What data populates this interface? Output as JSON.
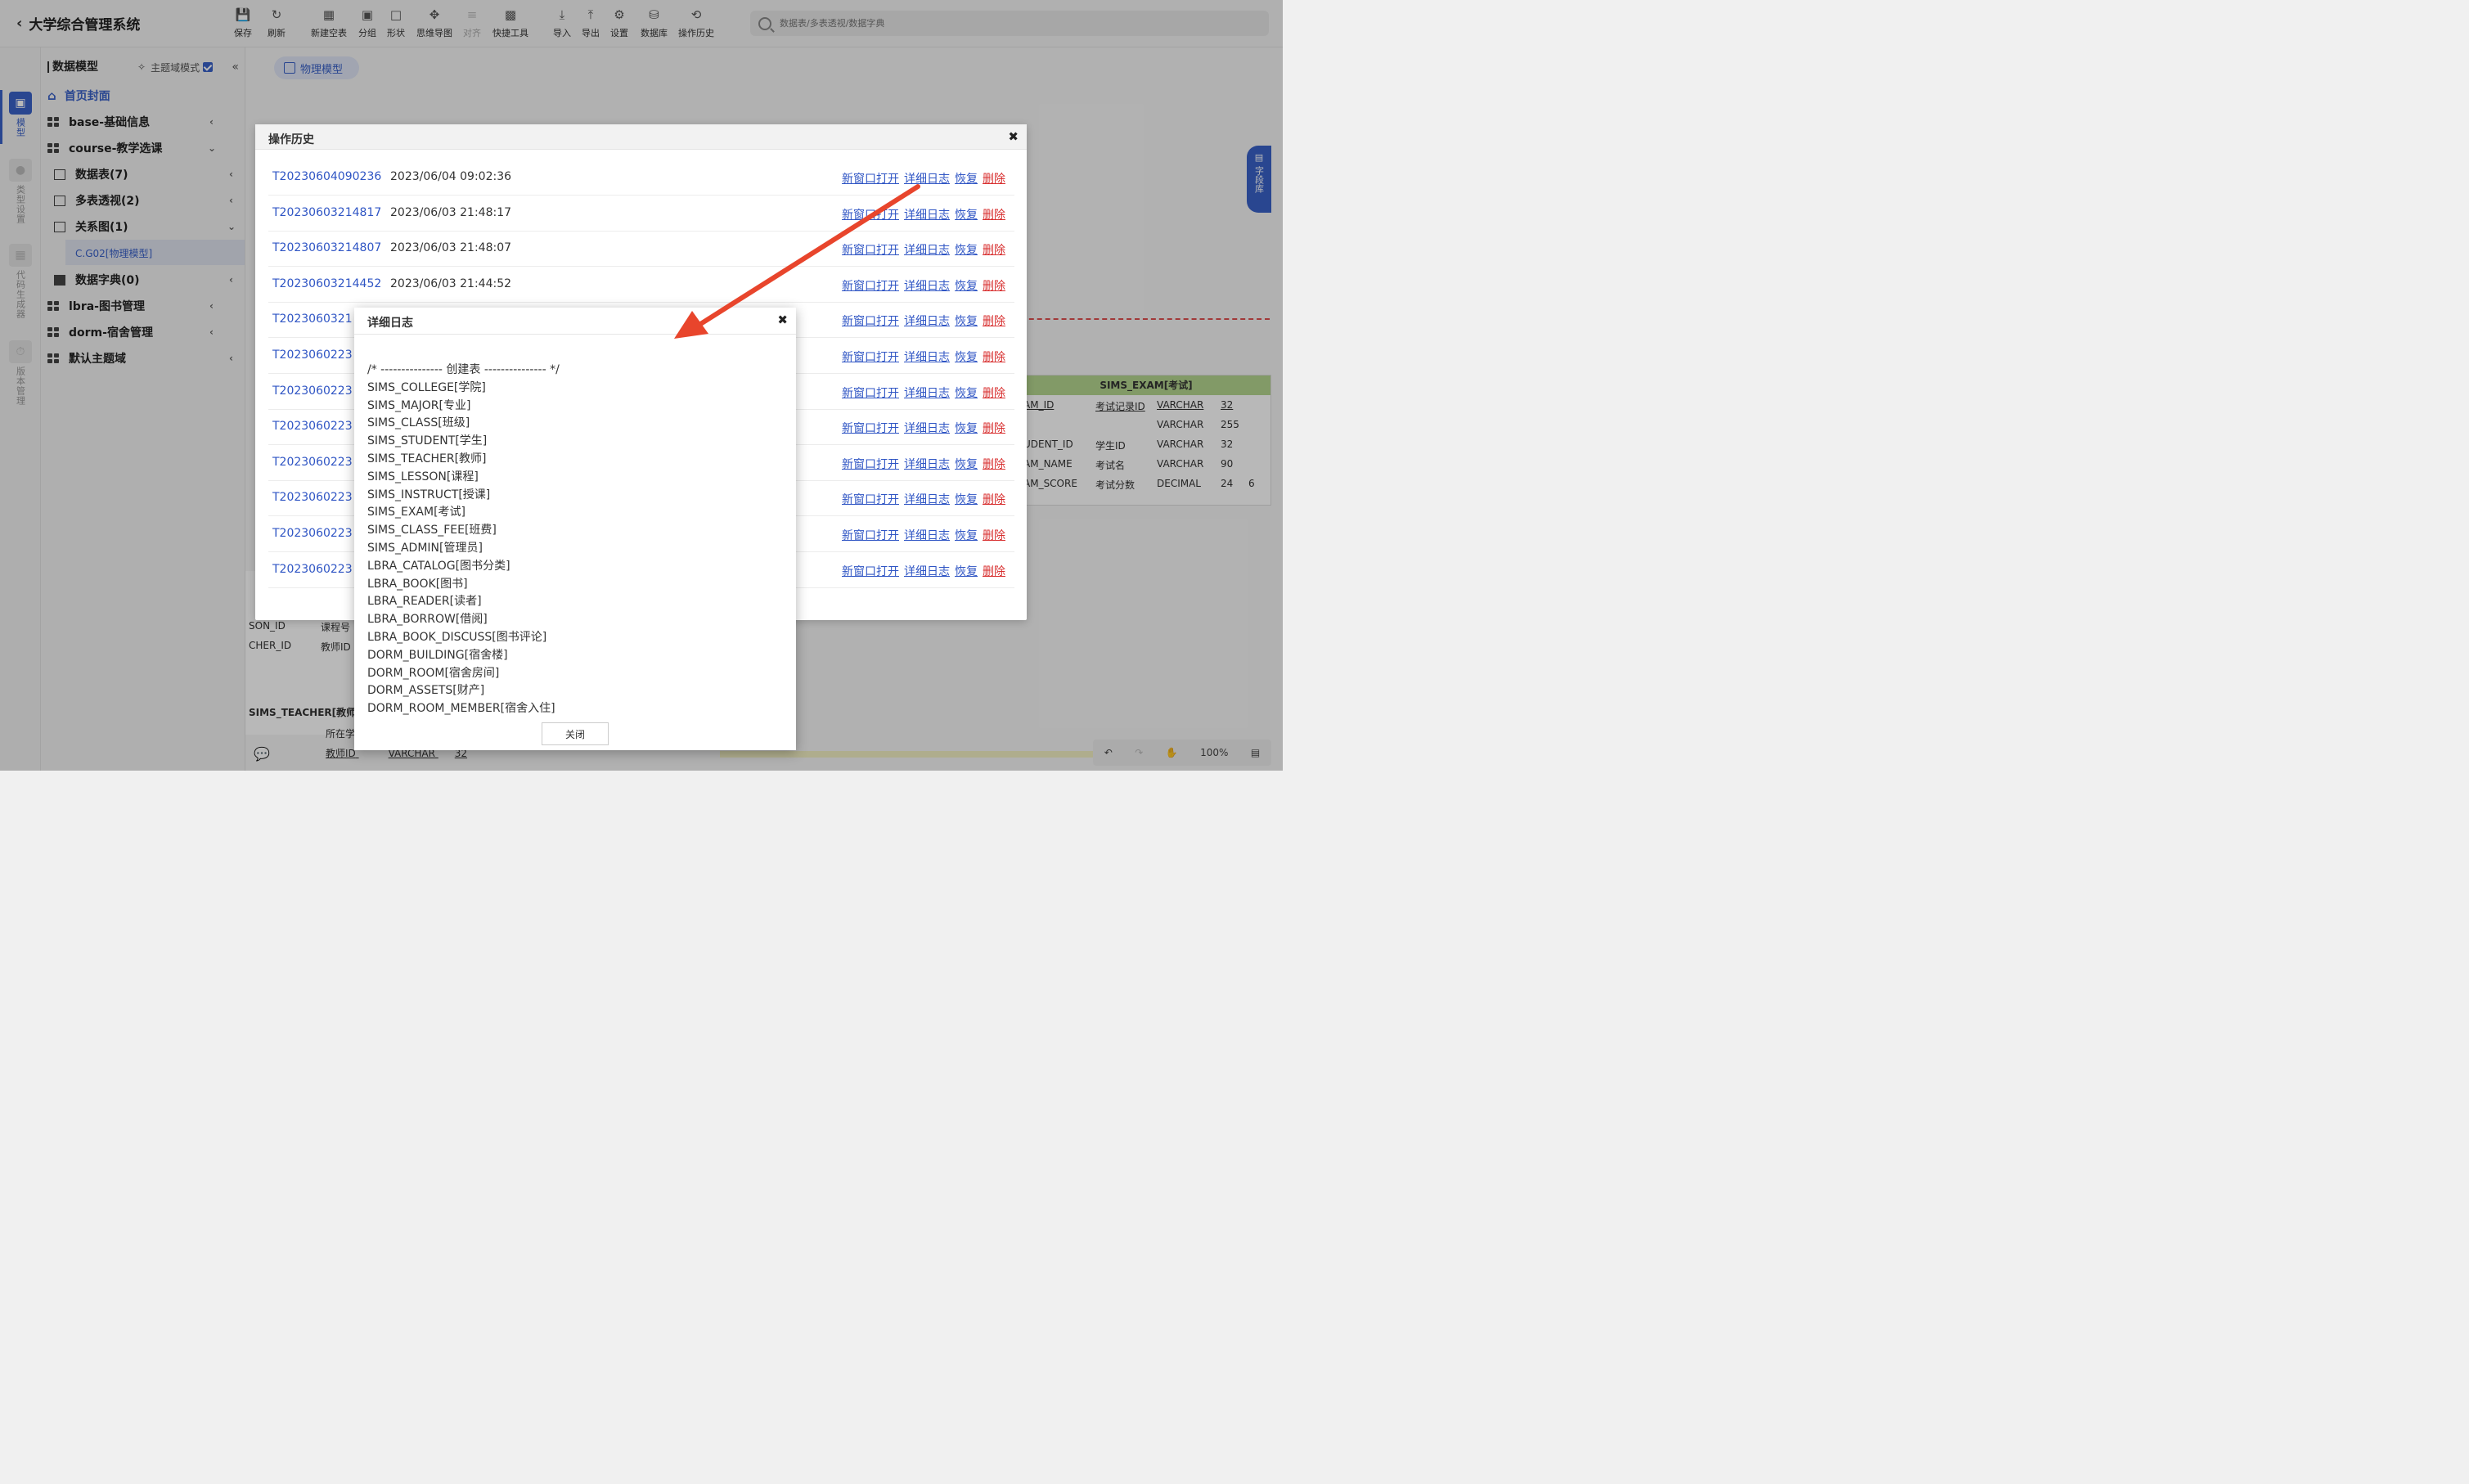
{
  "app": {
    "title": "大学综合管理系统"
  },
  "toolbar": {
    "save": "保存",
    "refresh": "刷新",
    "new_table": "新建空表",
    "group": "分组",
    "shape": "形状",
    "mindmap": "思维导图",
    "align": "对齐",
    "quick_tools": "快捷工具",
    "import": "导入",
    "export": "导出",
    "settings": "设置",
    "database": "数据库",
    "history": "操作历史"
  },
  "search": {
    "placeholder": "数据表/多表透视/数据字典"
  },
  "rail": {
    "model": "模型",
    "type_settings": "类型设置",
    "code_gen": "代码生成器",
    "version": "版本管理"
  },
  "tree": {
    "title": "数据模型",
    "mode_label": "主题域模式",
    "home": "首页封面",
    "nodes": {
      "base": "base-基础信息",
      "course": "course-教学选课",
      "tables": "数据表(7)",
      "pivot": "多表透视(2)",
      "diagram": "关系图(1)",
      "diagram_child": "C.G02[物理模型]",
      "dict": "数据字典(0)",
      "lbra": "lbra-图书管理",
      "dorm": "dorm-宿舍管理",
      "default": "默认主题域"
    }
  },
  "canvas": {
    "tab": "物理模型",
    "field_lib": "字段库",
    "er_table": {
      "title": "SIMS_EXAM[考试]",
      "rows": [
        [
          "AM_ID",
          "考试记录ID",
          "VARCHAR",
          "32",
          ""
        ],
        [
          "",
          "",
          "VARCHAR",
          "255",
          ""
        ],
        [
          "UDENT_ID",
          "学生ID",
          "VARCHAR",
          "32",
          ""
        ],
        [
          "AM_NAME",
          "考试名",
          "VARCHAR",
          "90",
          ""
        ],
        [
          "AM_SCORE",
          "考试分数",
          "DECIMAL",
          "24",
          "6"
        ]
      ]
    },
    "left_rows": [
      "SON_ID",
      "课程号",
      "CHER_ID",
      "教师ID"
    ],
    "teacher_title": "SIMS_TEACHER[教师]",
    "teacher_rows": [
      "所在学",
      "教师ID",
      "VARCHAR",
      "32"
    ],
    "zoom": "100%"
  },
  "history_dialog": {
    "title": "操作历史",
    "actions": {
      "open": "新窗口打开",
      "log": "详细日志",
      "restore": "恢复",
      "delete": "删除"
    },
    "rows": [
      {
        "id": "T20230604090236",
        "time": "2023/06/04 09:02:36"
      },
      {
        "id": "T20230603214817",
        "time": "2023/06/03 21:48:17"
      },
      {
        "id": "T20230603214807",
        "time": "2023/06/03 21:48:07"
      },
      {
        "id": "T20230603214452",
        "time": "2023/06/03 21:44:52"
      },
      {
        "id": "T2023060321",
        "time": ""
      },
      {
        "id": "T2023060223",
        "time": ""
      },
      {
        "id": "T2023060223",
        "time": ""
      },
      {
        "id": "T2023060223",
        "time": ""
      },
      {
        "id": "T2023060223",
        "time": ""
      },
      {
        "id": "T2023060223",
        "time": ""
      },
      {
        "id": "T2023060223",
        "time": ""
      },
      {
        "id": "T2023060223",
        "time": ""
      }
    ]
  },
  "detail_dialog": {
    "title": "详细日志",
    "close_label": "关闭",
    "lines": [
      "/* --------------- 创建表 --------------- */",
      "SIMS_COLLEGE[学院]",
      "SIMS_MAJOR[专业]",
      "SIMS_CLASS[班级]",
      "SIMS_STUDENT[学生]",
      "SIMS_TEACHER[教师]",
      "SIMS_LESSON[课程]",
      "SIMS_INSTRUCT[授课]",
      "SIMS_EXAM[考试]",
      "SIMS_CLASS_FEE[班费]",
      "SIMS_ADMIN[管理员]",
      "LBRA_CATALOG[图书分类]",
      "LBRA_BOOK[图书]",
      "LBRA_READER[读者]",
      "LBRA_BORROW[借阅]",
      "LBRA_BOOK_DISCUSS[图书评论]",
      "DORM_BUILDING[宿舍楼]",
      "DORM_ROOM[宿舍房间]",
      "DORM_ASSETS[财产]",
      "DORM_ROOM_MEMBER[宿舍入住]"
    ]
  },
  "colors": {
    "accent": "#3a61c8",
    "link": "#2f55c4",
    "danger": "#d83030",
    "arrow": "#e8452c"
  }
}
